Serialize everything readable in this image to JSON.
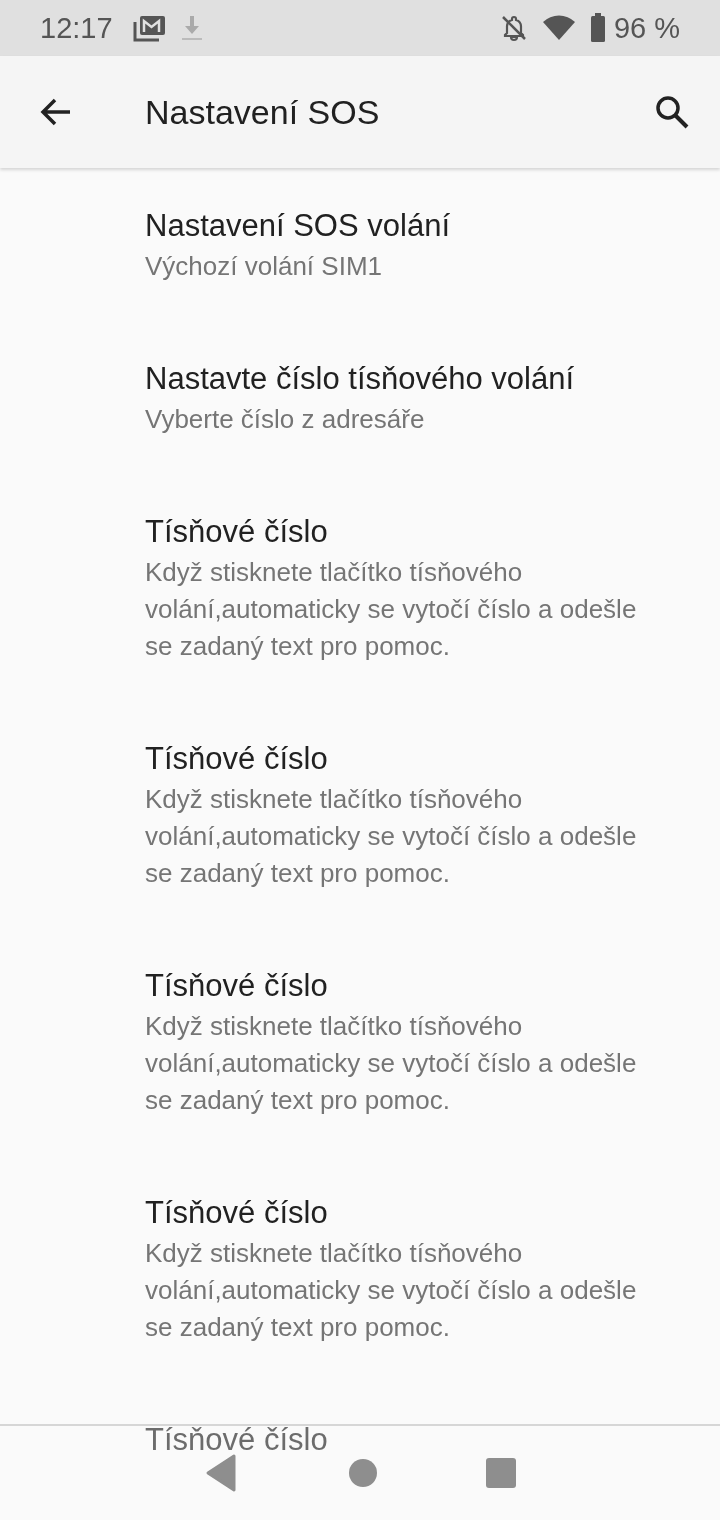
{
  "status_bar": {
    "time": "12:17",
    "battery_text": "96 %"
  },
  "app_bar": {
    "title": "Nastavení SOS"
  },
  "items": [
    {
      "title": "Nastavení SOS volání",
      "summary": "Výchozí volání SIM1"
    },
    {
      "title": "Nastavte číslo tísňového volání",
      "summary": "Vyberte číslo z adresáře"
    },
    {
      "title": "Tísňové číslo",
      "summary": "Když stisknete tlačítko tísňového volání,automaticky se vytočí číslo a odešle se zadaný text pro pomoc."
    },
    {
      "title": "Tísňové číslo",
      "summary": "Když stisknete tlačítko tísňového volání,automaticky se vytočí číslo a odešle se zadaný text pro pomoc."
    },
    {
      "title": "Tísňové číslo",
      "summary": "Když stisknete tlačítko tísňového volání,automaticky se vytočí číslo a odešle se zadaný text pro pomoc."
    },
    {
      "title": "Tísňové číslo",
      "summary": "Když stisknete tlačítko tísňového volání,automaticky se vytočí číslo a odešle se zadaný text pro pomoc."
    },
    {
      "title": "Tísňové číslo"
    }
  ]
}
